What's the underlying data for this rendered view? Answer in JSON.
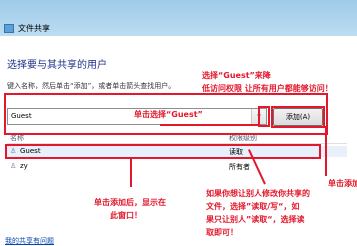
{
  "window": {
    "title": "文件共享"
  },
  "heading": "选择要与其共享的用户",
  "description": "键入名称，然后单击“添加”，或者单击箭头查找用户。",
  "user_input": {
    "value": "Guest",
    "dropdown_arrow": "▾"
  },
  "add_button": "添加(A)",
  "table": {
    "headers": [
      "名称",
      "权限级别"
    ],
    "rows": [
      {
        "name": "Guest",
        "permission": "读取",
        "icon": "user-icon"
      },
      {
        "name": "zy",
        "permission": "所有者",
        "icon": "user-icon"
      }
    ]
  },
  "help_link": "我的共享有问题",
  "annotations": {
    "guest_note_line1": "选择“Guest”来降",
    "guest_note_line2": "低访问权限 让所有用户都能够访问！",
    "click_select_guest": "单击选择“Guest”",
    "click_add": "单击添加",
    "after_add_line1": "单击添加后，显示在",
    "after_add_line2": "此窗口！",
    "perm_line1": "如果你想让别人修改你共享的",
    "perm_line2": "文件，选择”读取/写“，如",
    "perm_line3": "果只让别人”读取“，选择读",
    "perm_line4": "取即可！"
  },
  "colors": {
    "annotation_red": "#e3182c",
    "title_bar": "#9fcbe9",
    "heading_blue": "#1e3287"
  }
}
